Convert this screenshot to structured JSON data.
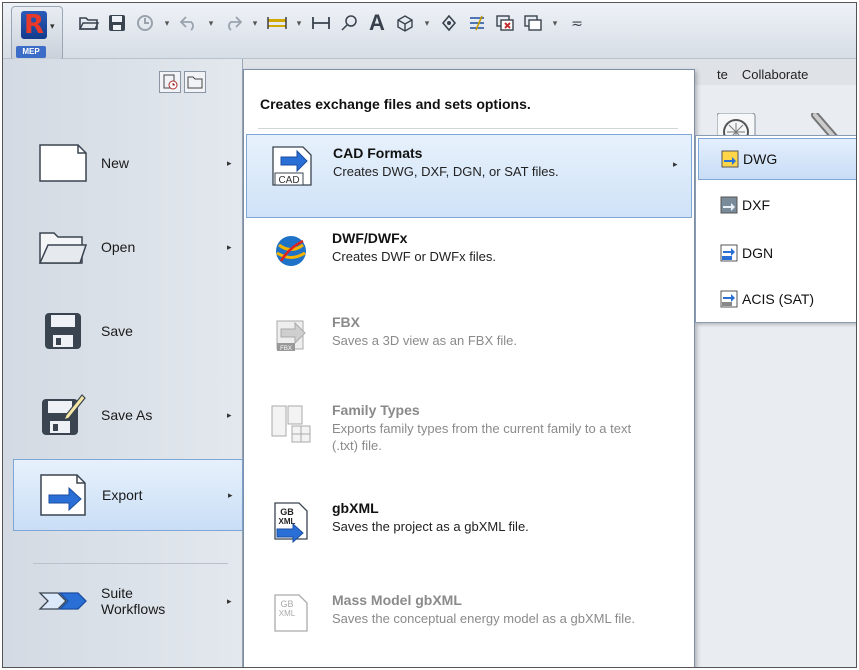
{
  "app": {
    "badge": "MEP",
    "logo_letter": "R",
    "logo_caret": "▾"
  },
  "qat": {
    "icons": [
      "open-icon",
      "save-icon",
      "sync-icon",
      "undo-icon",
      "redo-icon",
      "measure-icon",
      "dimension-icon",
      "tag-icon",
      "text-icon",
      "3d-view-icon",
      "section-icon",
      "thin-lines-icon",
      "close-windows-icon",
      "switch-windows-icon",
      "customize-icon"
    ]
  },
  "ribbon": {
    "tabs": [
      "te",
      "Collaborate"
    ]
  },
  "app_menu": {
    "items": [
      {
        "label": "New",
        "has_submenu": true,
        "active": false
      },
      {
        "label": "Open",
        "has_submenu": true,
        "active": false
      },
      {
        "label": "Save",
        "has_submenu": false,
        "active": false
      },
      {
        "label": "Save As",
        "has_submenu": true,
        "active": false
      },
      {
        "label": "Export",
        "has_submenu": true,
        "active": true
      },
      {
        "label": "Suite\nWorkflows",
        "has_submenu": true,
        "active": false
      }
    ],
    "submenu_arrow": "▸"
  },
  "export_menu": {
    "header": "Creates exchange files and sets options.",
    "items": [
      {
        "title": "CAD Formats",
        "desc": "Creates DWG, DXF, DGN, or SAT files.",
        "active": true,
        "enabled": true,
        "has_submenu": true,
        "icon": "cad-formats-icon"
      },
      {
        "title": "DWF/DWFx",
        "desc": "Creates DWF or DWFx files.",
        "active": false,
        "enabled": true,
        "has_submenu": false,
        "icon": "dwf-globe-icon"
      },
      {
        "title": "FBX",
        "desc": "Saves a 3D view as an FBX file.",
        "active": false,
        "enabled": false,
        "has_submenu": false,
        "icon": "fbx-icon"
      },
      {
        "title": "Family Types",
        "desc": "Exports family types from the current family to a text (.txt) file.",
        "active": false,
        "enabled": false,
        "has_submenu": false,
        "icon": "family-types-icon"
      },
      {
        "title": "gbXML",
        "desc": "Saves the project as a gbXML file.",
        "active": false,
        "enabled": true,
        "has_submenu": false,
        "icon": "gbxml-icon"
      },
      {
        "title": "Mass Model gbXML",
        "desc": "Saves the conceptual energy model as a gbXML file.",
        "active": false,
        "enabled": false,
        "has_submenu": false,
        "icon": "mass-model-gbxml-icon"
      }
    ]
  },
  "cad_flyout": {
    "items": [
      {
        "label": "DWG",
        "active": true,
        "icon": "dwg-icon"
      },
      {
        "label": "DXF",
        "active": false,
        "icon": "dxf-icon"
      },
      {
        "label": "DGN",
        "active": false,
        "icon": "dgn-icon"
      },
      {
        "label": "ACIS (SAT)",
        "active": false,
        "icon": "acis-sat-icon"
      }
    ]
  },
  "colors": {
    "highlight": "#cfe2f7",
    "highlight_border": "#7ea6d6",
    "disabled_text": "#8a8a8a",
    "export_arrow_blue": "#2a6fd6"
  }
}
